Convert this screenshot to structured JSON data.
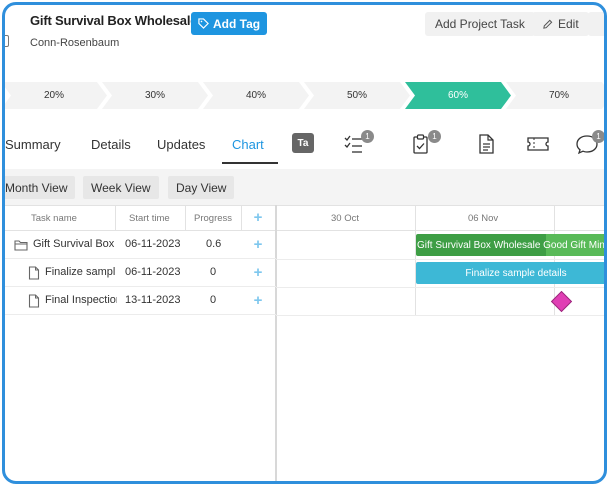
{
  "header": {
    "title": "Gift Survival Box Wholesale",
    "subtitle": "Conn-Rosenbaum",
    "add_tag_label": "Add Tag",
    "add_project_task_label": "Add Project Task",
    "edit_label": "Edit"
  },
  "stages": [
    {
      "label": "20%",
      "active": false
    },
    {
      "label": "30%",
      "active": false
    },
    {
      "label": "40%",
      "active": false
    },
    {
      "label": "50%",
      "active": false
    },
    {
      "label": "60%",
      "active": true
    },
    {
      "label": "70%",
      "active": false
    }
  ],
  "tabs": {
    "summary": "Summary",
    "details": "Details",
    "updates": "Updates",
    "chart": "Chart",
    "tag_icon_text": "Ta",
    "checklist_count": "1",
    "tasks_count": "1",
    "comments_count": "1"
  },
  "views": {
    "month": "Month View",
    "week": "Week View",
    "day": "Day View"
  },
  "grid": {
    "columns": [
      "Task name",
      "Start time",
      "Progress"
    ],
    "timeline": [
      "30 Oct",
      "06 Nov"
    ],
    "rows": [
      {
        "name": "Gift Survival Box W",
        "start": "06-11-2023",
        "progress": "0.6",
        "type": "folder"
      },
      {
        "name": "Finalize sample",
        "start": "06-11-2023",
        "progress": "0",
        "type": "file"
      },
      {
        "name": "Final Inspection",
        "start": "13-11-2023",
        "progress": "0",
        "type": "file"
      }
    ],
    "bars": {
      "project": "Gift Survival Box Wholesale Good Gift Mini M",
      "task": "Finalize sample details"
    }
  },
  "colors": {
    "accent": "#1e95e0",
    "active_stage": "#2fbf9b",
    "project_bar": "#4bb04f",
    "task_bar": "#3db8d6",
    "milestone": "#e03fb4",
    "frame": "#2f8fdc"
  }
}
